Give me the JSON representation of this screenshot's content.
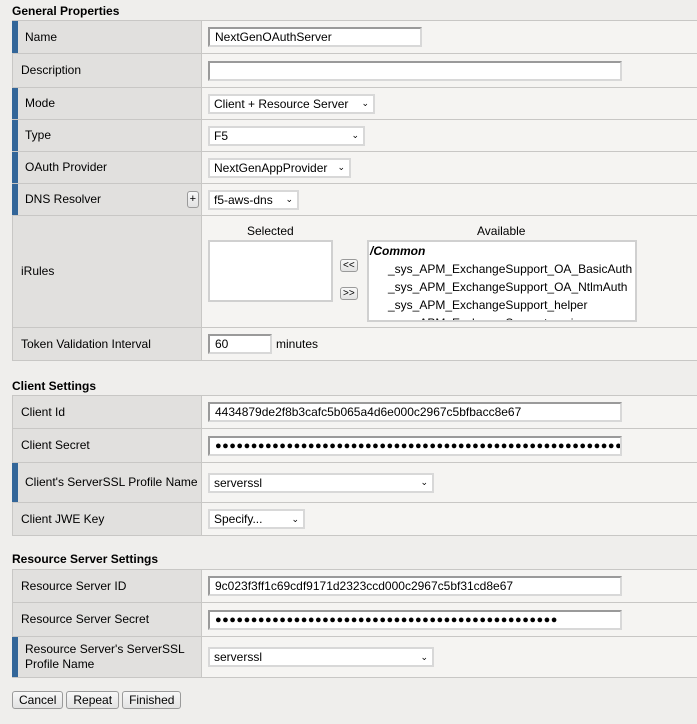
{
  "general": {
    "title": "General Properties",
    "name_label": "Name",
    "name_value": "NextGenOAuthServer",
    "description_label": "Description",
    "description_value": "",
    "mode_label": "Mode",
    "mode_value": "Client + Resource Server",
    "type_label": "Type",
    "type_value": "F5",
    "provider_label": "OAuth Provider",
    "provider_value": "NextGenAppProvider",
    "dns_label": "DNS Resolver",
    "dns_add": "+",
    "dns_value": "f5-aws-dns",
    "irules_label": "iRules",
    "selected_header": "Selected",
    "available_header": "Available",
    "move_left": "<<",
    "move_right": ">>",
    "available_items": [
      "/Common",
      "_sys_APM_ExchangeSupport_OA_BasicAuth",
      "_sys_APM_ExchangeSupport_OA_NtlmAuth",
      "_sys_APM_ExchangeSupport_helper",
      "_sys_APM_ExchangeSupport_main"
    ],
    "token_label": "Token Validation Interval",
    "token_value": "60",
    "token_unit": "minutes"
  },
  "client": {
    "title": "Client Settings",
    "id_label": "Client Id",
    "id_value": "4434879de2f8b3cafc5b065a4d6e000c2967c5bfbacc8e67",
    "secret_label": "Client Secret",
    "secret_value": "●●●●●●●●●●●●●●●●●●●●●●●●●●●●●●●●●●●●●●●●●●●●●●●●●●●●●●●●●●●●●●●●",
    "ssl_label": "Client's ServerSSL Profile Name",
    "ssl_value": "serverssl",
    "jwe_label": "Client JWE Key",
    "jwe_value": "Specify..."
  },
  "resource": {
    "title": "Resource Server Settings",
    "id_label": "Resource Server ID",
    "id_value": "9c023f3ff1c69cdf9171d2323ccd000c2967c5bf31cd8e67",
    "secret_label": "Resource Server Secret",
    "secret_value": "●●●●●●●●●●●●●●●●●●●●●●●●●●●●●●●●●●●●●●●●●●●●●●●●",
    "ssl_label": "Resource Server's ServerSSL Profile Name",
    "ssl_value": "serverssl"
  },
  "buttons": {
    "cancel": "Cancel",
    "repeat": "Repeat",
    "finished": "Finished"
  },
  "colors": {
    "required_marker": "#336699"
  }
}
